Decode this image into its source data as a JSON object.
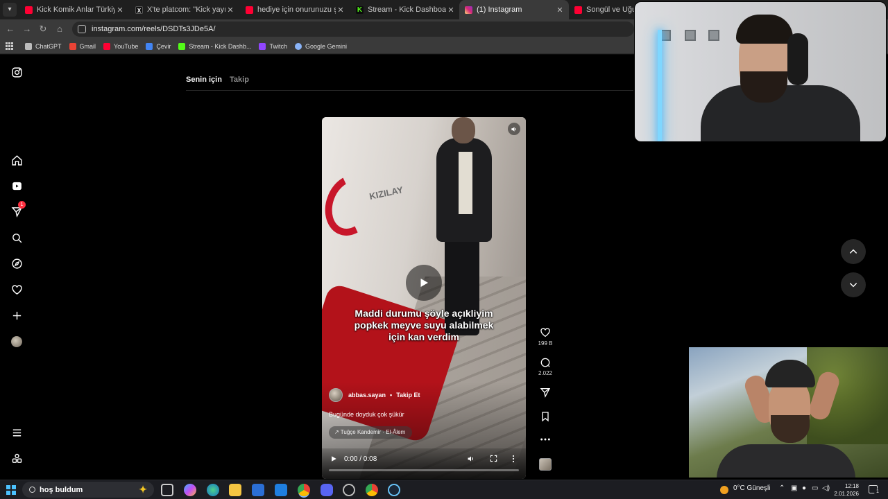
{
  "browser": {
    "tabs": [
      {
        "title": "Kick Komik Anlar Türkiye Rewin",
        "icon": "youtube-icon",
        "active": false
      },
      {
        "title": "X'te platcom: \"Kick yayıncısı Ca",
        "icon": "x-icon",
        "active": false
      },
      {
        "title": "hediye için onurunuzu şerefiniz",
        "icon": "youtube-icon",
        "active": false
      },
      {
        "title": "Stream - Kick Dashboard",
        "icon": "kick-icon",
        "active": false
      },
      {
        "title": "(1) Instagram",
        "icon": "instagram-icon",
        "active": true
      },
      {
        "title": "Songül ve Uğur ile S",
        "icon": "youtube-icon",
        "active": false
      }
    ],
    "tab_close_glyph": "✕",
    "url": "instagram.com/reels/DSDTs3JDe5A/",
    "bookmarks": [
      {
        "label": "ChatGPT",
        "icon": "chatgpt-icon",
        "color": "#bbbbbb"
      },
      {
        "label": "Gmail",
        "icon": "gmail-icon",
        "color": "#ea4335"
      },
      {
        "label": "YouTube",
        "icon": "youtube-icon",
        "color": "#ff0033"
      },
      {
        "label": "Çevir",
        "icon": "translate-icon",
        "color": "#4285f4"
      },
      {
        "label": "Stream - Kick Dashb...",
        "icon": "kick-icon",
        "color": "#53fc18"
      },
      {
        "label": "Twitch",
        "icon": "twitch-icon",
        "color": "#9146ff"
      },
      {
        "label": "Google Gemini",
        "icon": "gemini-icon",
        "color": "#8ab4f8"
      }
    ]
  },
  "instagram": {
    "feed_tabs": [
      "Senin için",
      "Takip"
    ],
    "nav_badge": "1",
    "reel": {
      "overlay_lines": [
        "Maddi durumu şöyle açıkliyim",
        "popkek meyve suyu alabilmek",
        "için kan verdim"
      ],
      "wall_text": "KIZILAY",
      "author": "abbas.sayan",
      "separator": "•",
      "follow_label": "Takip Et",
      "description": "Bugünde doyduk çok şükür",
      "music": "↗ Tuğçe Kandemir · El-Âlem",
      "time": "0:00 / 0:08",
      "progress": 0.0
    },
    "actions": {
      "likes": "199 B",
      "comments": "2.022"
    }
  },
  "taskbar": {
    "search_text": "hoş buldum",
    "weather": "0°C  Güneşli",
    "time": "12:18",
    "date": "2.01.2026",
    "notification_count": "1",
    "accent": "#4cc2ff"
  }
}
